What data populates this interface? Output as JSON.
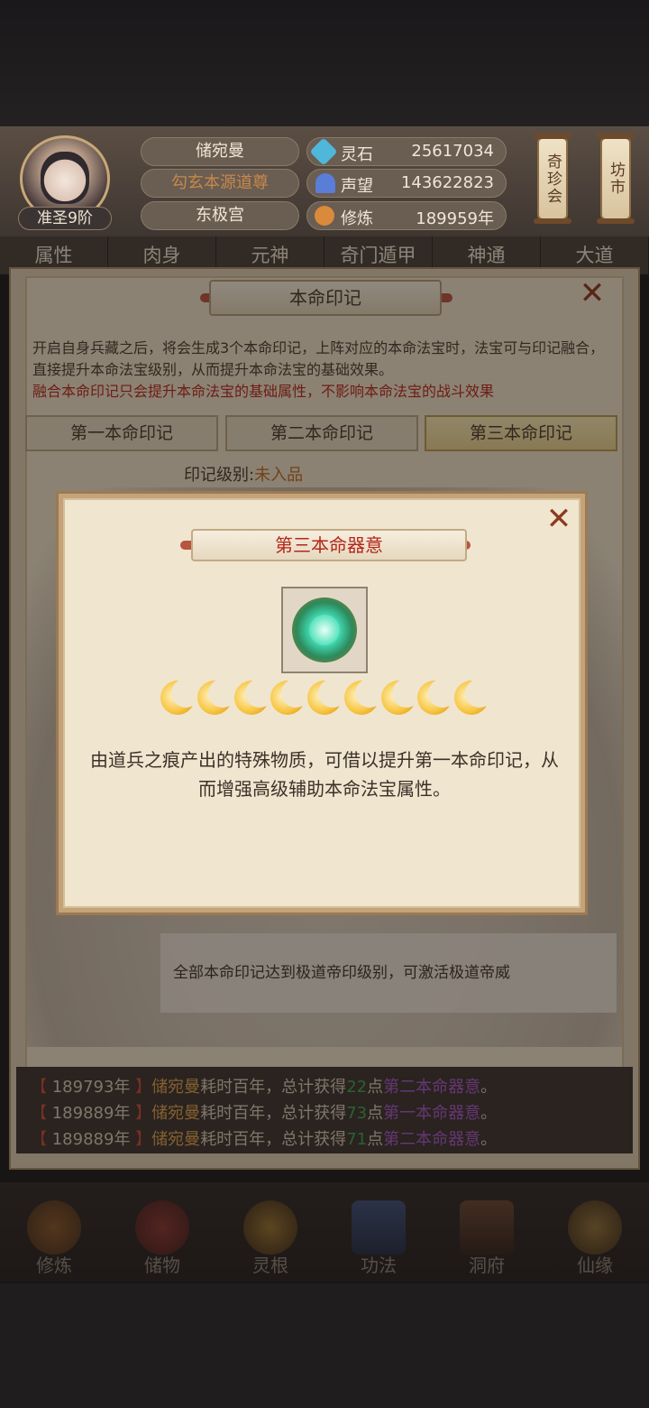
{
  "header": {
    "player_name": "储宛曼",
    "player_title": "勾玄本源道尊",
    "sect": "东极宫",
    "realm": "准圣9阶",
    "stats": [
      {
        "label": "灵石",
        "value": "25617034",
        "icon": "spirit-stone-icon",
        "color": "#4fb7d9"
      },
      {
        "label": "声望",
        "value": "143622823",
        "icon": "reputation-crystal-icon",
        "color": "#5a7ed8"
      },
      {
        "label": "修炼",
        "value": "189959年",
        "icon": "meditation-icon",
        "color": "#d98a3a"
      }
    ],
    "side_buttons": [
      "奇珍会",
      "坊市"
    ]
  },
  "tabs": [
    "属性",
    "肉身",
    "元神",
    "奇门遁甲",
    "神通",
    "大道"
  ],
  "panel": {
    "title": "本命印记",
    "description": "开启自身兵藏之后，将会生成3个本命印记，上阵对应的本命法宝时，法宝可与印记融合，直接提升本命法宝级别，从而提升本命法宝的基础效果。",
    "warning": "融合本命印记只会提升本命法宝的基础属性，不影响本命法宝的战斗效果",
    "subtabs": [
      "第一本命印记",
      "第二本命印记",
      "第三本命印记"
    ],
    "active_subtab": 2,
    "level_label": "印记级别:",
    "level_value": "未入品",
    "info": "全部本命印记达到极道帝印级别，可激活极道帝威"
  },
  "logs": [
    {
      "year": "189793年",
      "name": "储宛曼",
      "text1": "耗时百年，总计获得",
      "num": "22",
      "unit": "点",
      "item": "第二本命器意",
      "end": "。"
    },
    {
      "year": "189889年",
      "name": "储宛曼",
      "text1": "耗时百年，总计获得",
      "num": "73",
      "unit": "点",
      "item": "第一本命器意",
      "end": "。"
    },
    {
      "year": "189889年",
      "name": "储宛曼",
      "text1": "耗时百年，总计获得",
      "num": "71",
      "unit": "点",
      "item": "第二本命器意",
      "end": "。"
    }
  ],
  "modal": {
    "title": "第三本命器意",
    "moon_count": 9,
    "description": "由道兵之痕产出的特殊物质，可借以提升第一本命印记，从而增强高级辅助本命法宝属性。"
  },
  "bottom_nav": [
    "修炼",
    "储物",
    "灵根",
    "功法",
    "洞府",
    "仙缘"
  ],
  "close_symbol": "✕"
}
